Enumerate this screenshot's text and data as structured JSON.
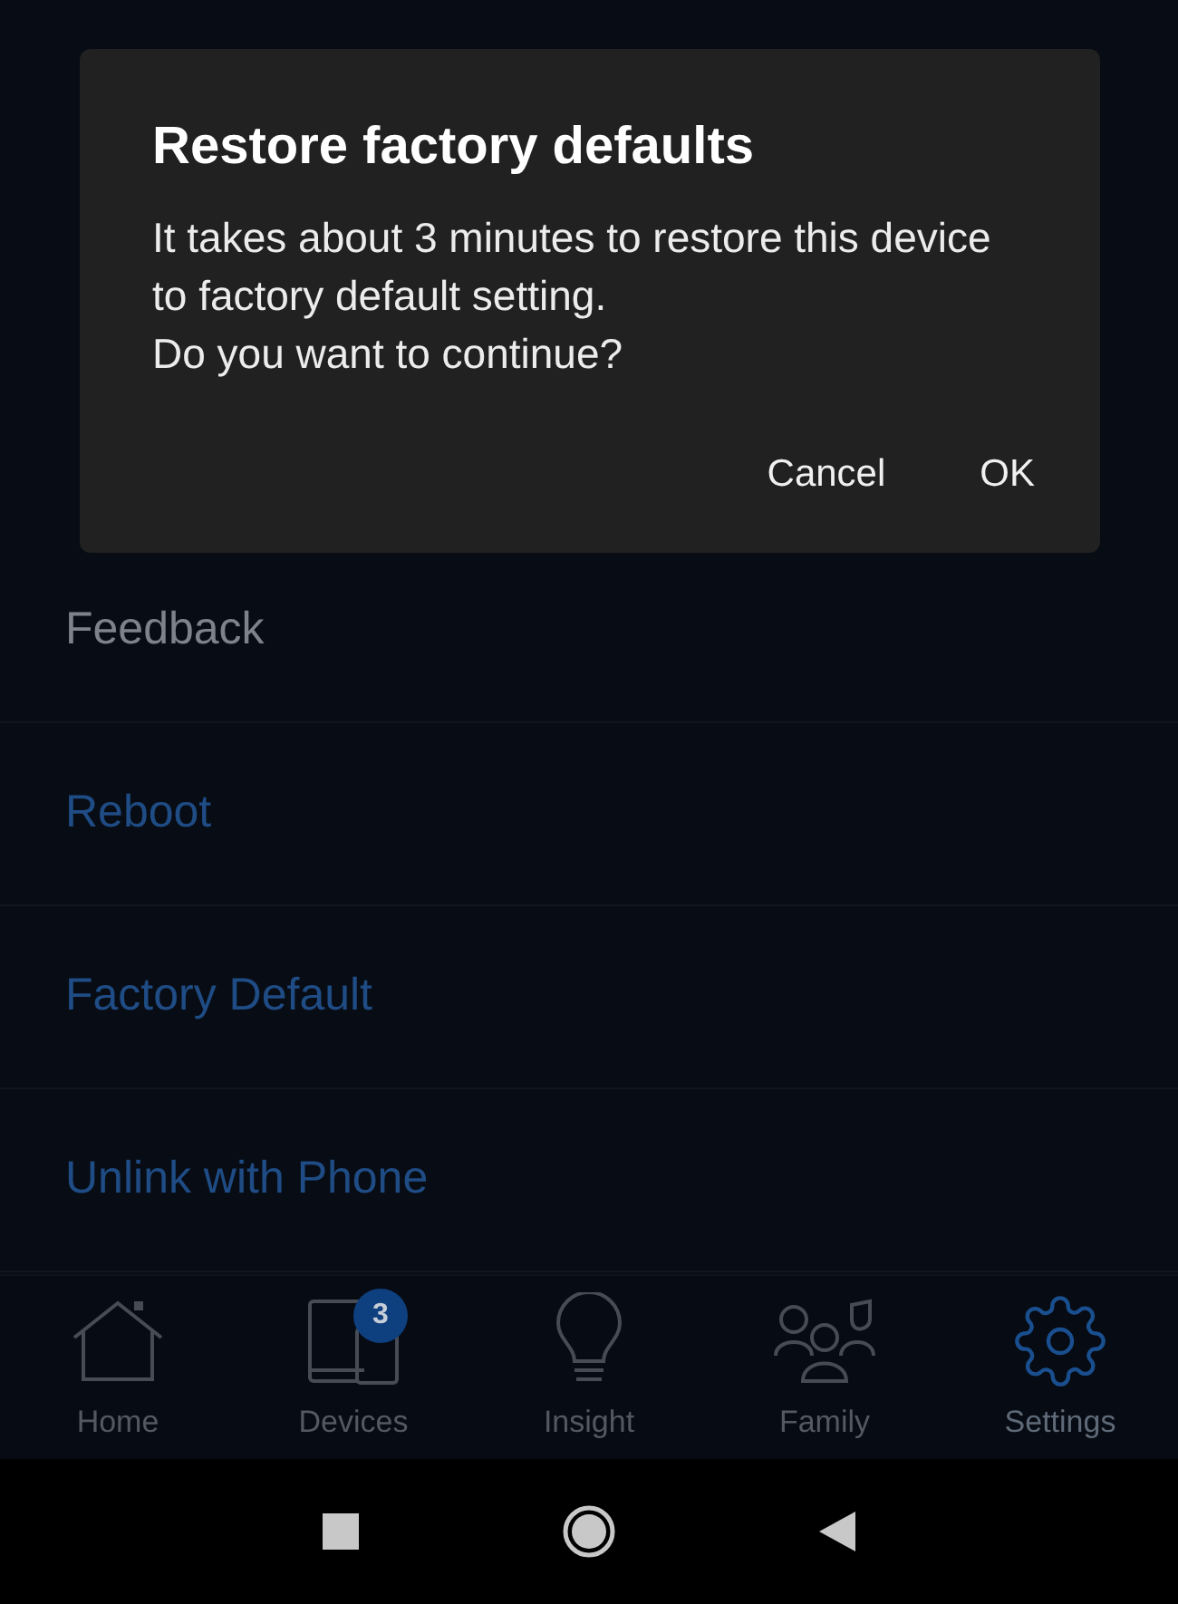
{
  "menu": [
    {
      "label": "Feedback",
      "kind": "normal"
    },
    {
      "label": "Reboot",
      "kind": "action"
    },
    {
      "label": "Factory Default",
      "kind": "action"
    },
    {
      "label": "Unlink with Phone",
      "kind": "action"
    }
  ],
  "dialog": {
    "title": "Restore factory defaults",
    "message": "It takes about 3 minutes to restore this device to factory default setting.\nDo you want to continue?",
    "buttons": [
      "Cancel",
      "OK"
    ]
  },
  "nav": [
    {
      "label": "Home",
      "selected": false
    },
    {
      "label": "Devices",
      "selected": false,
      "badge": "3"
    },
    {
      "label": "Insight",
      "selected": false
    },
    {
      "label": "Family",
      "selected": false
    },
    {
      "label": "Settings",
      "selected": true
    }
  ]
}
